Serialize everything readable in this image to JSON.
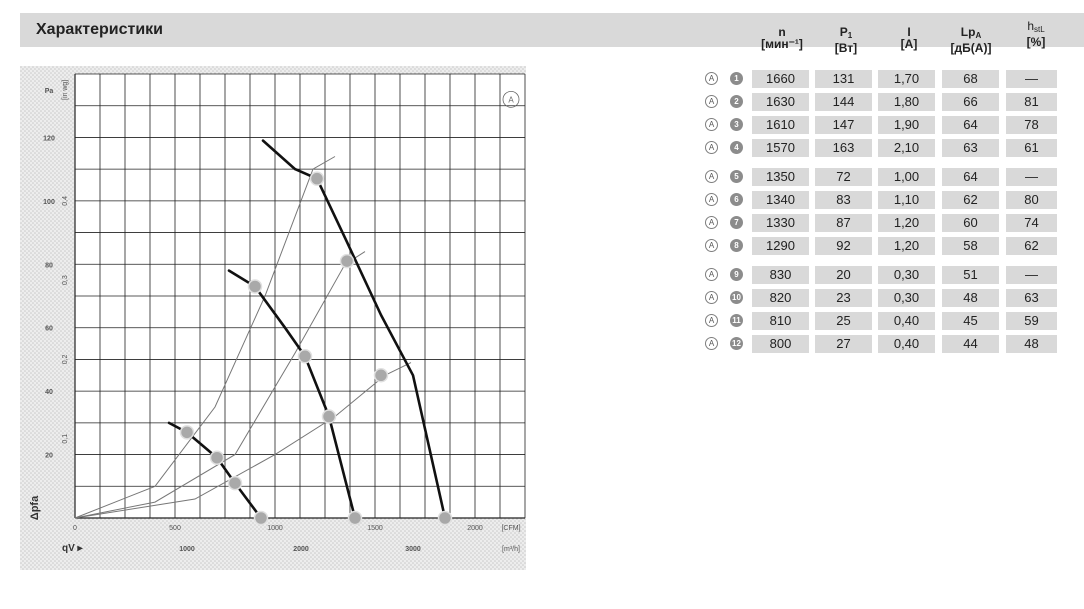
{
  "header": {
    "title": "Характеристики"
  },
  "columns": [
    {
      "name": "n",
      "unit": "[мин⁻¹]"
    },
    {
      "name": "P",
      "sub": "1",
      "unit": "[Вт]"
    },
    {
      "name": "I",
      "unit": "[A]"
    },
    {
      "name": "Lp",
      "sub": "A",
      "unit": "[дБ(A)]"
    },
    {
      "name": "h",
      "sub": "stL",
      "unit": "[%]"
    }
  ],
  "rows": [
    {
      "mark": "A",
      "id": "1",
      "n": "1660",
      "p1": "131",
      "i": "1,70",
      "lpa": "68",
      "eff": "—"
    },
    {
      "mark": "A",
      "id": "2",
      "n": "1630",
      "p1": "144",
      "i": "1,80",
      "lpa": "66",
      "eff": "81"
    },
    {
      "mark": "A",
      "id": "3",
      "n": "1610",
      "p1": "147",
      "i": "1,90",
      "lpa": "64",
      "eff": "78"
    },
    {
      "mark": "A",
      "id": "4",
      "n": "1570",
      "p1": "163",
      "i": "2,10",
      "lpa": "63",
      "eff": "61"
    },
    {
      "mark": "A",
      "id": "5",
      "n": "1350",
      "p1": "72",
      "i": "1,00",
      "lpa": "64",
      "eff": "—"
    },
    {
      "mark": "A",
      "id": "6",
      "n": "1340",
      "p1": "83",
      "i": "1,10",
      "lpa": "62",
      "eff": "80"
    },
    {
      "mark": "A",
      "id": "7",
      "n": "1330",
      "p1": "87",
      "i": "1,20",
      "lpa": "60",
      "eff": "74"
    },
    {
      "mark": "A",
      "id": "8",
      "n": "1290",
      "p1": "92",
      "i": "1,20",
      "lpa": "58",
      "eff": "62"
    },
    {
      "mark": "A",
      "id": "9",
      "n": "830",
      "p1": "20",
      "i": "0,30",
      "lpa": "51",
      "eff": "—"
    },
    {
      "mark": "A",
      "id": "10",
      "n": "820",
      "p1": "23",
      "i": "0,30",
      "lpa": "48",
      "eff": "63"
    },
    {
      "mark": "A",
      "id": "11",
      "n": "810",
      "p1": "25",
      "i": "0,40",
      "lpa": "45",
      "eff": "59"
    },
    {
      "mark": "A",
      "id": "12",
      "n": "800",
      "p1": "27",
      "i": "0,40",
      "lpa": "44",
      "eff": "48"
    }
  ],
  "chart_data": {
    "type": "line",
    "xlabel": "qV",
    "ylabel": "Δpfa",
    "corner_label": "A",
    "xlim": [
      0,
      2250
    ],
    "ylim": [
      0,
      140
    ],
    "x_ticks_top": [
      "0",
      "500",
      "1000",
      "1500",
      "2000",
      "[CFM]"
    ],
    "x_ticks_bottom": [
      "1000",
      "2000",
      "3000",
      "[m³/h]"
    ],
    "y_ticks_left": [
      "20",
      "40",
      "60",
      "80",
      "100",
      "120",
      "Pa"
    ],
    "y_ticks_inner": [
      "0,1",
      "0,2",
      "0,3",
      "0,4",
      "[in wg]"
    ],
    "grid": true,
    "series": [
      {
        "x": [
          940,
          1100,
          1210,
          1360,
          1530,
          1690,
          1850
        ],
        "y": [
          119,
          110,
          107,
          87,
          64,
          45,
          0
        ]
      },
      {
        "x": [
          770,
          900,
          1050,
          1150,
          1270,
          1400
        ],
        "y": [
          78,
          73,
          60,
          51,
          32,
          0
        ]
      },
      {
        "x": [
          470,
          560,
          710,
          800,
          930
        ],
        "y": [
          30,
          27,
          19,
          11,
          0
        ]
      }
    ],
    "system_curves": [
      {
        "x": [
          0,
          400,
          700,
          950,
          1190,
          1300
        ],
        "y": [
          0,
          10,
          35,
          70,
          110,
          114
        ]
      },
      {
        "x": [
          0,
          400,
          800,
          1100,
          1350,
          1450
        ],
        "y": [
          0,
          5,
          20,
          52,
          80,
          84
        ]
      },
      {
        "x": [
          0,
          600,
          1000,
          1300,
          1550,
          1680
        ],
        "y": [
          0,
          6,
          20,
          32,
          45,
          49
        ]
      }
    ],
    "points": [
      {
        "label": "1",
        "x": 1210,
        "y": 107
      },
      {
        "label": "2",
        "x": 1360,
        "y": 81
      },
      {
        "label": "3",
        "x": 1530,
        "y": 45
      },
      {
        "label": "4",
        "x": 1850,
        "y": 0
      },
      {
        "label": "5",
        "x": 900,
        "y": 73
      },
      {
        "label": "6",
        "x": 1150,
        "y": 51
      },
      {
        "label": "7",
        "x": 1270,
        "y": 32
      },
      {
        "label": "8",
        "x": 1400,
        "y": 0
      },
      {
        "label": "9",
        "x": 560,
        "y": 27
      },
      {
        "label": "10",
        "x": 710,
        "y": 19
      },
      {
        "label": "11",
        "x": 800,
        "y": 11
      },
      {
        "label": "12",
        "x": 930,
        "y": 0
      }
    ]
  }
}
